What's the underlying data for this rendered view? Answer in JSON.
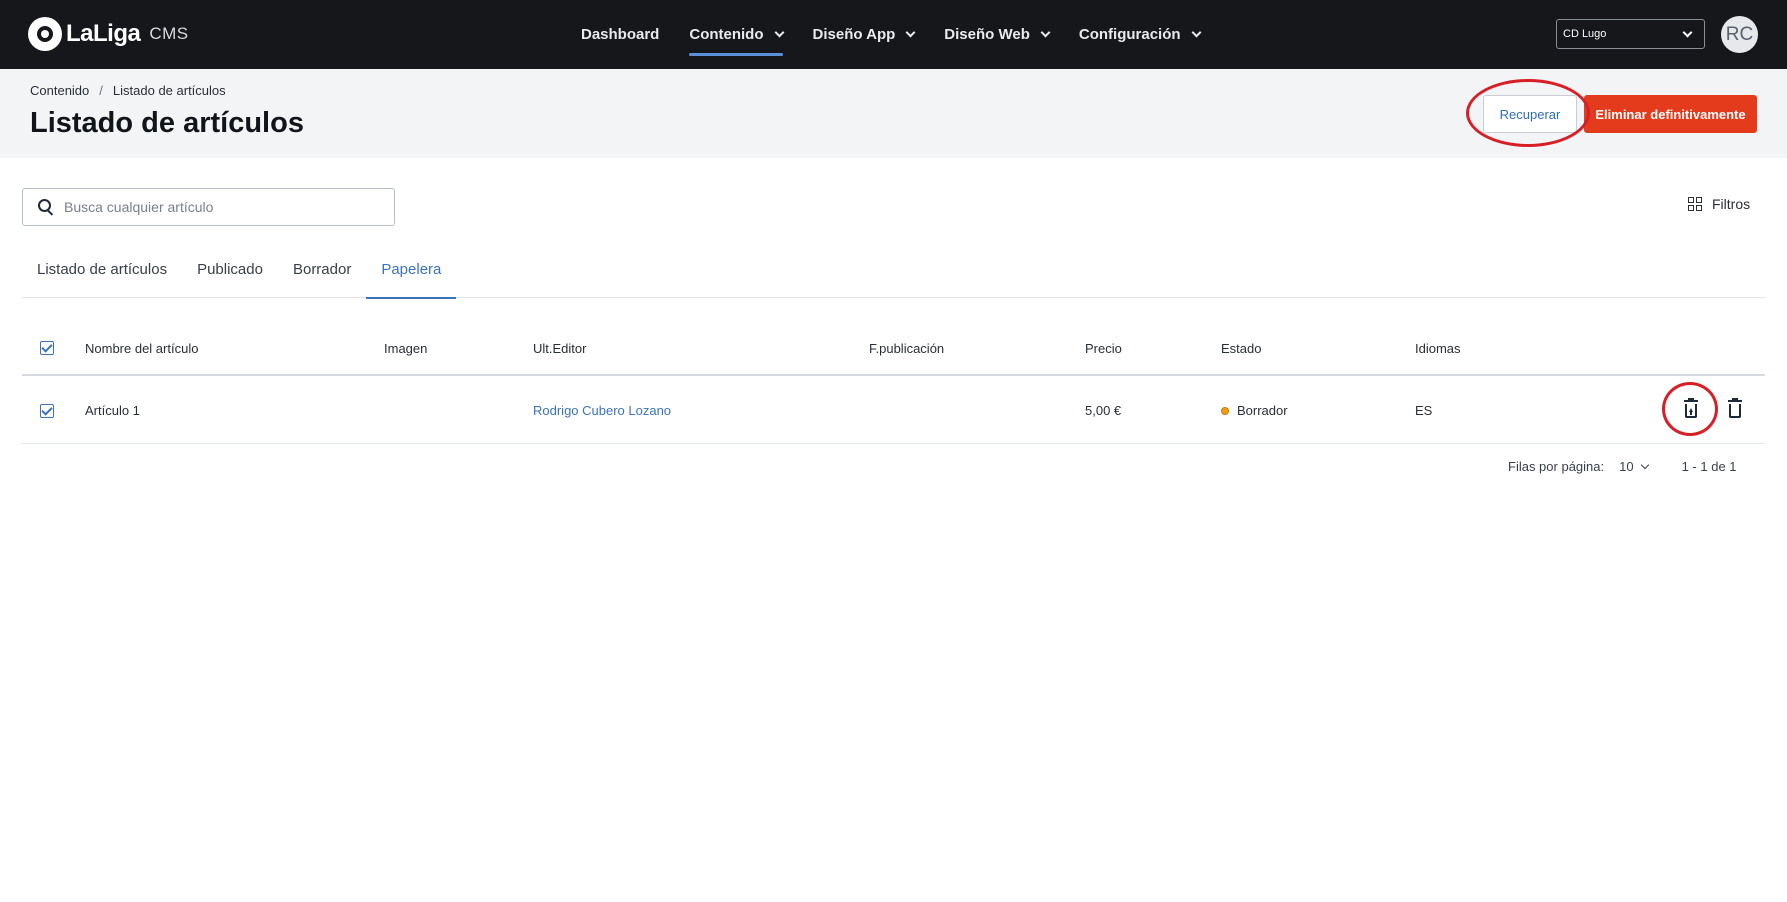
{
  "app": {
    "logo_text": "LaLiga",
    "logo_suffix": "CMS"
  },
  "nav": [
    {
      "label": "Dashboard",
      "has_dropdown": false,
      "active": false
    },
    {
      "label": "Contenido",
      "has_dropdown": true,
      "active": true
    },
    {
      "label": "Diseño App",
      "has_dropdown": true,
      "active": false
    },
    {
      "label": "Diseño Web",
      "has_dropdown": true,
      "active": false
    },
    {
      "label": "Configuración",
      "has_dropdown": true,
      "active": false
    }
  ],
  "club_select": {
    "value": "CD Lugo"
  },
  "user": {
    "initials": "RC"
  },
  "breadcrumb": {
    "parent": "Contenido",
    "separator": "/",
    "current": "Listado de artículos"
  },
  "page": {
    "title": "Listado de artículos"
  },
  "actions": {
    "recover_label": "Recuperar",
    "delete_label": "Eliminar definitivamente"
  },
  "search": {
    "placeholder": "Busca cualquier artículo"
  },
  "filters": {
    "label": "Filtros"
  },
  "tabs": [
    {
      "label": "Listado de artículos",
      "active": false
    },
    {
      "label": "Publicado",
      "active": false
    },
    {
      "label": "Borrador",
      "active": false
    },
    {
      "label": "Papelera",
      "active": true
    }
  ],
  "table": {
    "columns": [
      "Nombre del artículo",
      "Imagen",
      "Ult.Editor",
      "F.publicación",
      "Precio",
      "Estado",
      "Idiomas"
    ],
    "rows": [
      {
        "checked": true,
        "name": "Artículo 1",
        "image": "",
        "editor": "Rodrigo Cubero Lozano",
        "published": "",
        "price": "5,00 €",
        "status": "Borrador",
        "languages": "ES"
      }
    ]
  },
  "pagination": {
    "rows_label": "Filas por página:",
    "rows_value": "10",
    "range": "1 - 1 de 1"
  },
  "colors": {
    "topbar": "#15171b",
    "accent": "#3c74bc",
    "danger": "#e43b1d",
    "annotation": "#d81f26",
    "status_draft": "#f39c12"
  }
}
